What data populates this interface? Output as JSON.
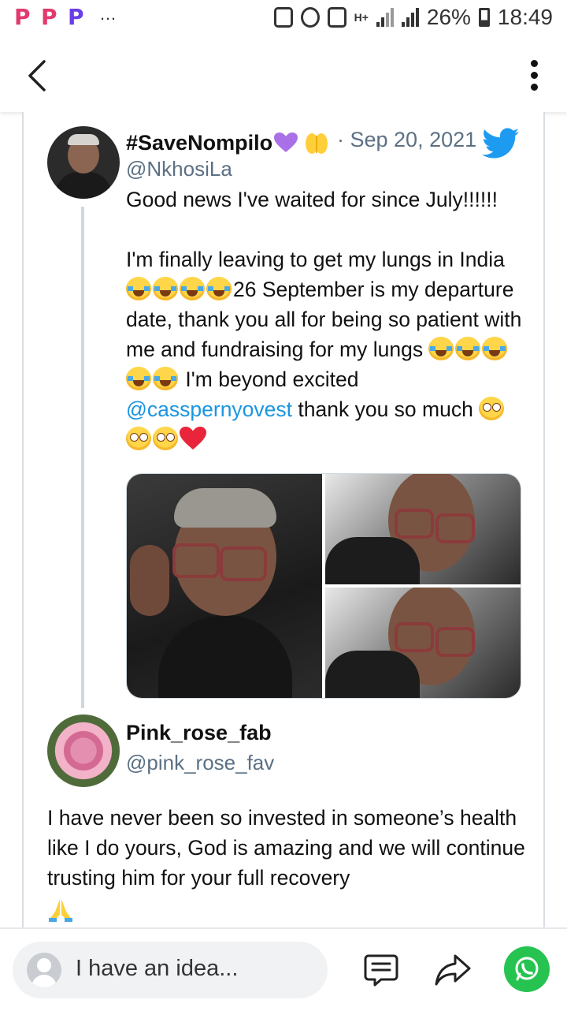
{
  "status_bar": {
    "app_icons": [
      "P",
      "P",
      "P"
    ],
    "more": "…",
    "network": "H+",
    "battery": "26%",
    "time": "18:49"
  },
  "app_bar": {
    "back_icon": "chevron-left-icon",
    "menu_icon": "more-vertical-icon"
  },
  "tweet": {
    "display_name": "#SaveNompilo",
    "date": "· Sep 20, 2021",
    "handle": "@NkhosiLa",
    "line1": "Good news I've waited for since July!!!!!!",
    "p2_a": "I'm finally leaving to get my lungs in India ",
    "p2_b": "26 September is my departure date, thank you all for being so patient with me and fundraising for my lungs ",
    "p2_c": " I'm beyond excited ",
    "mention": "@casspernyovest",
    "p2_d": " thank you so much ",
    "brand_color": "#1d9bf0",
    "mention_color": "#1b95e0"
  },
  "reply": {
    "display_name": "Pink_rose_fab",
    "handle": "@pink_rose_fav",
    "text": "I have never been so invested in someone’s health like I do yours, God is amazing and we will continue trusting him for your full recovery"
  },
  "bottom_bar": {
    "compose_placeholder": "I have an idea...",
    "comment_icon": "comment-icon",
    "share_icon": "share-icon",
    "whatsapp_icon": "whatsapp-icon",
    "whatsapp_color": "#27c351"
  }
}
